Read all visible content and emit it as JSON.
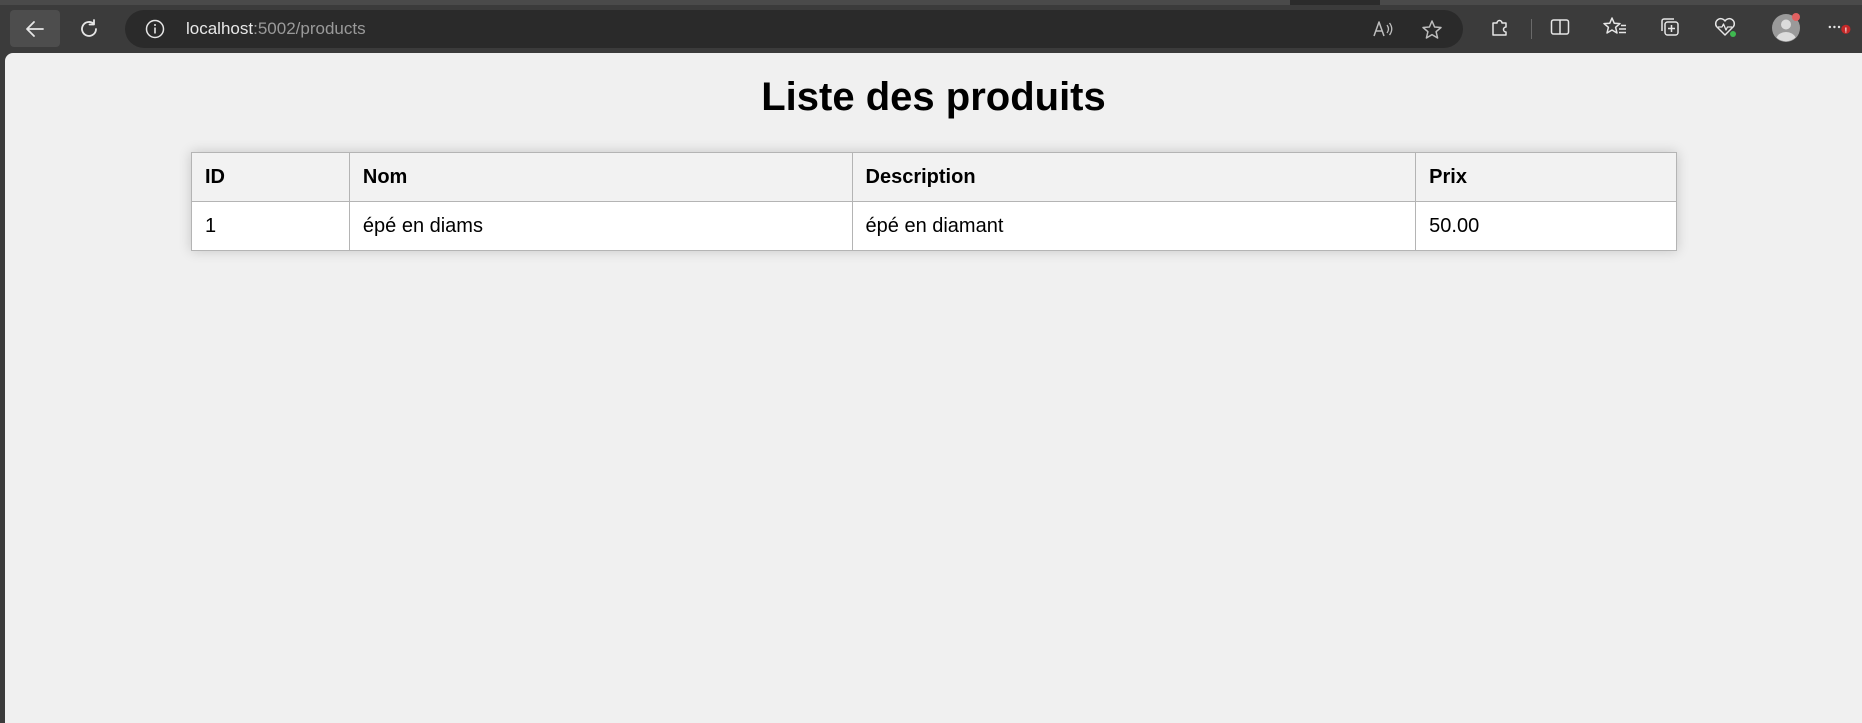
{
  "browser": {
    "url_host": "localhost",
    "url_rest": ":5002/products",
    "icons": {
      "back": "back-arrow-icon",
      "reload": "reload-icon",
      "info": "info-icon",
      "read_aloud": "read-aloud-icon",
      "favorite": "star-icon",
      "extensions": "puzzle-icon",
      "split_screen": "split-screen-icon",
      "favorites": "favorites-icon",
      "collections": "collections-icon",
      "health": "heart-pulse-icon",
      "profile": "profile-avatar-icon",
      "more": "more-dots-icon"
    },
    "profile_badge": "!",
    "accent_badge": "#e06060",
    "health_badge": "#3fb950"
  },
  "page": {
    "title": "Liste des produits",
    "table": {
      "headers": [
        "ID",
        "Nom",
        "Description",
        "Prix"
      ],
      "rows": [
        [
          "1",
          "épé en diams",
          "épé en diamant",
          "50.00"
        ]
      ]
    }
  }
}
